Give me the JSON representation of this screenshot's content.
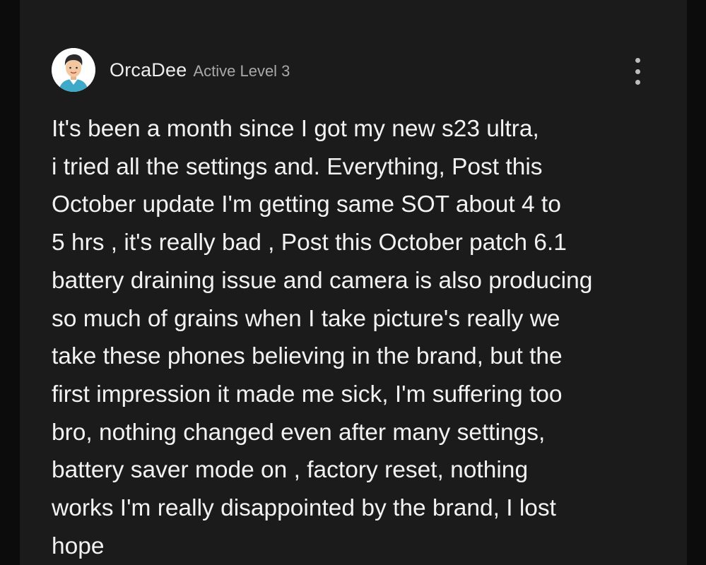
{
  "post": {
    "author": {
      "name": "OrcaDee",
      "rank": "Active Level 3",
      "avatar_icon": "user-avatar-icon"
    },
    "menu_icon": "more-vertical-icon",
    "body_lines": [
      "It's been a month since I got my new s23 ultra,",
      "i tried all the settings and. Everything, Post this",
      "October update I'm getting same SOT about 4 to",
      "5 hrs , it's really bad , Post this October patch 6.1",
      "battery draining issue and camera is also producing",
      "so much of grains when I take picture's really we",
      "take these phones believing in the brand, but the",
      "first impression it made me sick, I'm suffering too",
      "bro, nothing changed even after many settings,",
      "battery saver mode on , factory reset, nothing",
      "works I'm really disappointed by the brand, I lost",
      "hope"
    ]
  },
  "colors": {
    "page_background": "#0c0c0c",
    "card_background": "#1b1b1b",
    "text_primary": "#f2f2f2",
    "text_secondary": "#a9a9a9"
  }
}
